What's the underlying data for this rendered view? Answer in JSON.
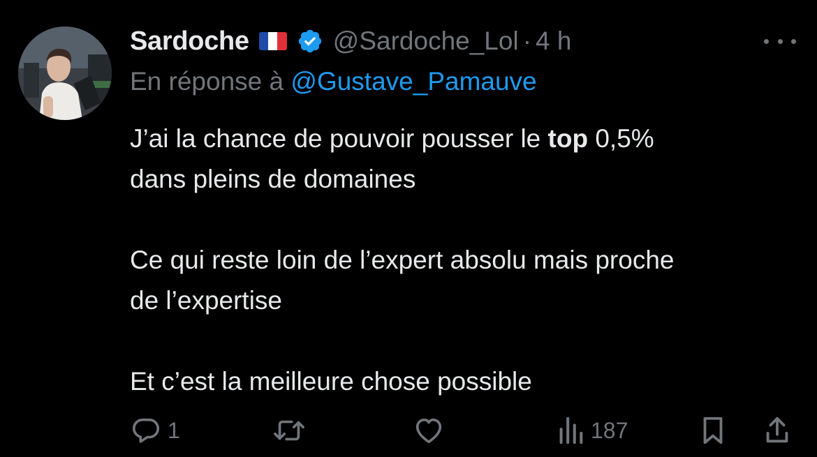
{
  "tweet": {
    "author": {
      "display_name": "Sardoche",
      "handle": "@Sardoche_Lol",
      "flag": "french-flag",
      "verified": true
    },
    "separator": "·",
    "time": "4 h",
    "reply_prefix": "En réponse à",
    "reply_to": "@Gustave_Pamauve",
    "body": {
      "line1_before": "J’ai la chance de pouvoir pousser le ",
      "line1_bold": "top",
      "line1_after": " 0,5%",
      "line2": "dans pleins de domaines",
      "line3": "Ce qui reste loin de l’expert absolu mais proche",
      "line4": "de l’expertise",
      "line5": "Et c’est la meilleure chose possible"
    },
    "actions": {
      "reply_count": "1",
      "retweet_count": "",
      "like_count": "",
      "views_count": "187"
    }
  },
  "icons": {
    "reply": "reply-icon",
    "retweet": "retweet-icon",
    "like": "heart-icon",
    "views": "views-icon",
    "bookmark": "bookmark-icon",
    "share": "share-icon",
    "more": "more-icon",
    "verified": "verified-badge-icon"
  },
  "colors": {
    "background": "#000000",
    "text": "#e7e9ea",
    "secondary": "#71767b",
    "link": "#1d9bf0",
    "verified": "#1d9bf0"
  }
}
